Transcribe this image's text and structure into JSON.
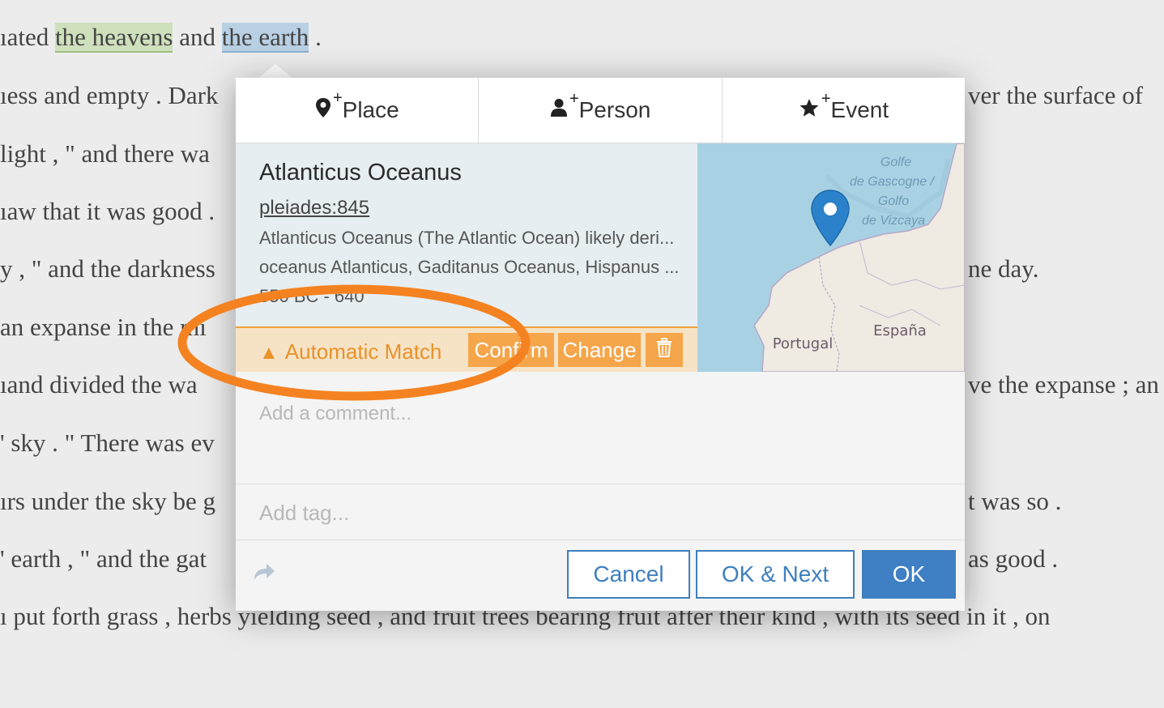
{
  "document": {
    "line1": {
      "prefix": "ıated ",
      "hl1": "the heavens",
      "mid": " and ",
      "hl2": "the earth",
      "suffix": " ."
    },
    "left_fragments": [
      "ıess and empty . Dark",
      " light , \" and there wa",
      "ıaw that it was good .",
      "y , \" and the darkness",
      " an expanse in the mi",
      "ıand divided the wa",
      "' sky . \" There was ev",
      "ırs under the sky be g",
      "' earth , \" and the gat"
    ],
    "right_fragments": [
      "ver the surface of",
      "ne day.",
      "ve the expanse ; an",
      "t was so .",
      "as good ."
    ],
    "bottom_line": "ı put forth grass , herbs yielding seed , and fruit trees bearing fruit after their kind , with its seed in it , on"
  },
  "tabs": [
    {
      "label": "Place",
      "icon": "map-marker-plus-icon"
    },
    {
      "label": "Person",
      "icon": "user-plus-icon"
    },
    {
      "label": "Event",
      "icon": "star-plus-icon"
    }
  ],
  "place": {
    "title": "Atlanticus Oceanus",
    "uri": "pleiades:845",
    "description": "Atlanticus Oceanus (The Atlantic Ocean) likely deri...",
    "names": "oceanus Atlanticus, Gaditanus Oceanus, Hispanus ...",
    "date": "550 BC - 640"
  },
  "match": {
    "label": "Automatic Match",
    "confirm": "Confirm",
    "change": "Change"
  },
  "map": {
    "labels": [
      "Golfe",
      "de Gascogne /",
      "Golfo",
      "de Vizcaya",
      "Portugal",
      "España"
    ]
  },
  "comment_placeholder": "Add a comment...",
  "tag_placeholder": "Add tag...",
  "footer": {
    "cancel": "Cancel",
    "ok_next": "OK & Next",
    "ok": "OK"
  },
  "colors": {
    "accent": "#3f7fc4",
    "match": "#f5a54a",
    "annotation": "#f58220"
  }
}
